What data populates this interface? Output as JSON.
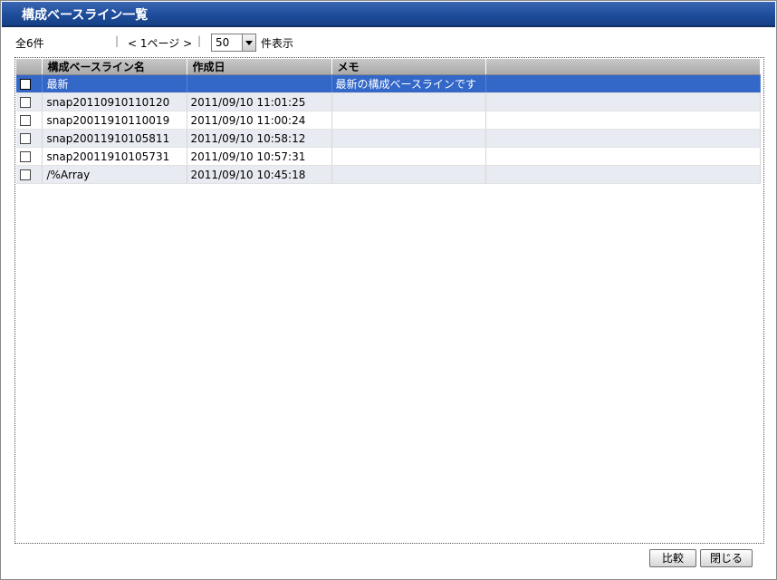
{
  "window": {
    "title": "構成ベースライン一覧"
  },
  "toolbar": {
    "total": "全6件",
    "sep": "|",
    "pager": "< 1ページ >",
    "page_size": "50",
    "page_size_suffix": "件表示"
  },
  "table": {
    "columns": [
      "構成ベースライン名",
      "作成日",
      "メモ"
    ],
    "rows": [
      {
        "name": "最新",
        "date": "",
        "memo": "最新の構成ベースラインです",
        "selected": true
      },
      {
        "name": "snap20110910110120",
        "date": "2011/09/10 11:01:25",
        "memo": ""
      },
      {
        "name": "snap20011910110019",
        "date": "2011/09/10 11:00:24",
        "memo": ""
      },
      {
        "name": "snap20011910105811",
        "date": "2011/09/10 10:58:12",
        "memo": ""
      },
      {
        "name": "snap20011910105731",
        "date": "2011/09/10 10:57:31",
        "memo": ""
      },
      {
        "name": "/%Array",
        "date": "2011/09/10 10:45:18",
        "memo": ""
      }
    ]
  },
  "buttons": {
    "compare": "比較",
    "close": "閉じる"
  },
  "colors": {
    "titlebar": "#1f4d9b",
    "selection": "#3367c8",
    "stripe": "#e8ebf2"
  }
}
